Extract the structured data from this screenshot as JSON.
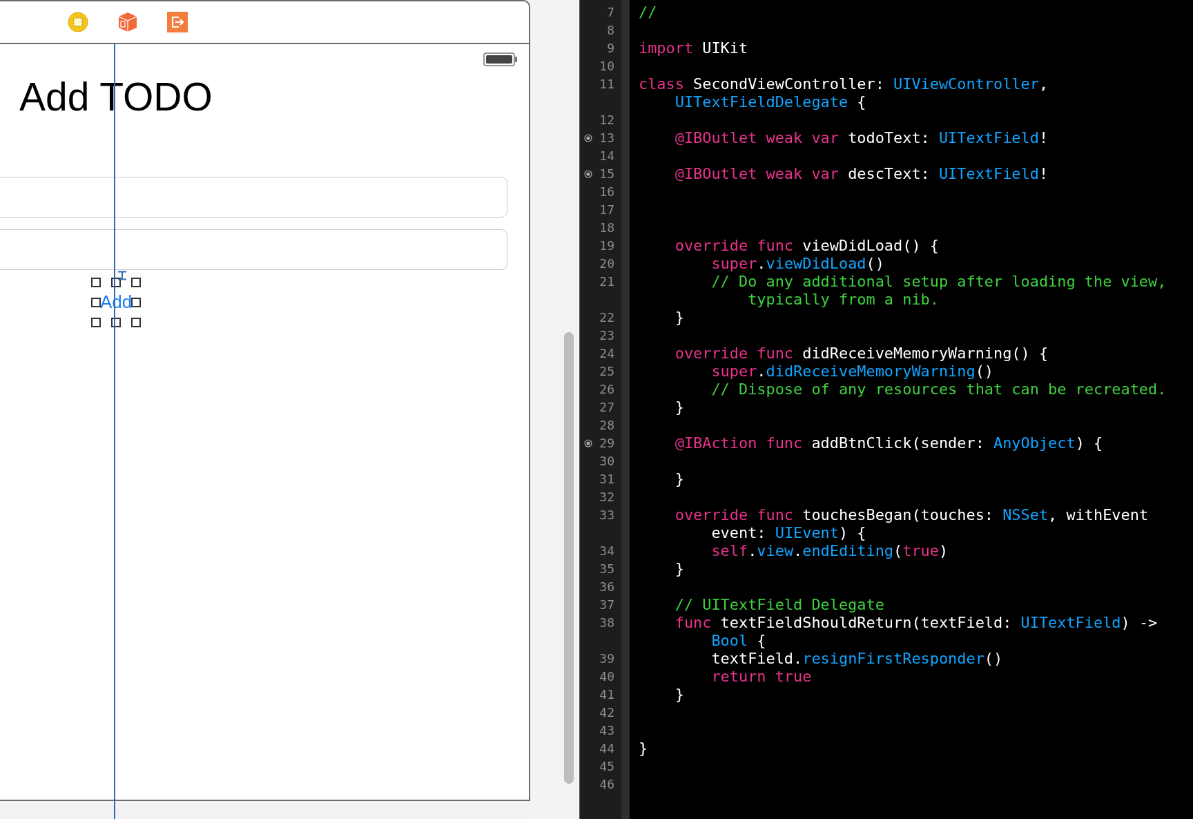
{
  "canvas": {
    "title": "Add TODO",
    "text_fields": [
      {
        "kind": "field"
      },
      {
        "kind": "field"
      }
    ],
    "button": {
      "label": "Add",
      "selected": true
    }
  },
  "editor": {
    "lines": [
      {
        "number": "7",
        "connected": false,
        "tokens": [
          {
            "kind": "comment",
            "text": "//"
          }
        ]
      },
      {
        "number": "8",
        "connected": false
      },
      {
        "number": "9",
        "connected": false,
        "tokens": [
          {
            "kind": "keyword",
            "text": "import"
          },
          {
            "kind": "plain",
            "text": " UIKit"
          }
        ]
      },
      {
        "number": "10",
        "connected": false
      },
      {
        "number": "11",
        "connected": false,
        "tokens": [
          {
            "kind": "keyword",
            "text": "class"
          },
          {
            "kind": "plain",
            "text": " SecondViewController: "
          },
          {
            "kind": "type",
            "text": "UIViewController"
          },
          {
            "kind": "plain",
            "text": ","
          }
        ],
        "wrap": [
          {
            "kind": "type",
            "text": "    UITextFieldDelegate"
          },
          {
            "kind": "plain",
            "text": " {"
          }
        ]
      },
      {
        "number": "12",
        "connected": false
      },
      {
        "number": "13",
        "connected": true,
        "tokens": [
          {
            "kind": "keyword",
            "text": "    @IBOutlet weak var"
          },
          {
            "kind": "plain",
            "text": " todoText: "
          },
          {
            "kind": "type",
            "text": "UITextField"
          },
          {
            "kind": "plain",
            "text": "!"
          }
        ]
      },
      {
        "number": "14",
        "connected": false
      },
      {
        "number": "15",
        "connected": true,
        "tokens": [
          {
            "kind": "keyword",
            "text": "    @IBOutlet weak var"
          },
          {
            "kind": "plain",
            "text": " descText: "
          },
          {
            "kind": "type",
            "text": "UITextField"
          },
          {
            "kind": "plain",
            "text": "!"
          }
        ]
      },
      {
        "number": "16",
        "connected": false
      },
      {
        "number": "17",
        "connected": false
      },
      {
        "number": "18",
        "connected": false
      },
      {
        "number": "19",
        "connected": false,
        "tokens": [
          {
            "kind": "keyword",
            "text": "    override func"
          },
          {
            "kind": "plain",
            "text": " viewDidLoad() {"
          }
        ]
      },
      {
        "number": "20",
        "connected": false,
        "tokens": [
          {
            "kind": "keyword",
            "text": "        super"
          },
          {
            "kind": "plain",
            "text": "."
          },
          {
            "kind": "type",
            "text": "viewDidLoad"
          },
          {
            "kind": "plain",
            "text": "()"
          }
        ]
      },
      {
        "number": "21",
        "connected": false,
        "tokens": [
          {
            "kind": "comment",
            "text": "        // Do any additional setup after loading the view,"
          }
        ],
        "wrap": [
          {
            "kind": "comment",
            "text": "            typically from a nib."
          }
        ]
      },
      {
        "number": "22",
        "connected": false,
        "tokens": [
          {
            "kind": "plain",
            "text": "    }"
          }
        ]
      },
      {
        "number": "23",
        "connected": false
      },
      {
        "number": "24",
        "connected": false,
        "tokens": [
          {
            "kind": "keyword",
            "text": "    override func"
          },
          {
            "kind": "plain",
            "text": " didReceiveMemoryWarning() {"
          }
        ]
      },
      {
        "number": "25",
        "connected": false,
        "tokens": [
          {
            "kind": "keyword",
            "text": "        super"
          },
          {
            "kind": "plain",
            "text": "."
          },
          {
            "kind": "type",
            "text": "didReceiveMemoryWarning"
          },
          {
            "kind": "plain",
            "text": "()"
          }
        ]
      },
      {
        "number": "26",
        "connected": false,
        "tokens": [
          {
            "kind": "comment",
            "text": "        // Dispose of any resources that can be recreated."
          }
        ]
      },
      {
        "number": "27",
        "connected": false,
        "tokens": [
          {
            "kind": "plain",
            "text": "    }"
          }
        ]
      },
      {
        "number": "28",
        "connected": false
      },
      {
        "number": "29",
        "connected": true,
        "tokens": [
          {
            "kind": "keyword",
            "text": "    @IBAction func"
          },
          {
            "kind": "plain",
            "text": " addBtnClick(sender: "
          },
          {
            "kind": "type",
            "text": "AnyObject"
          },
          {
            "kind": "plain",
            "text": ") {"
          }
        ]
      },
      {
        "number": "30",
        "connected": false
      },
      {
        "number": "31",
        "connected": false,
        "tokens": [
          {
            "kind": "plain",
            "text": "    }"
          }
        ]
      },
      {
        "number": "32",
        "connected": false
      },
      {
        "number": "33",
        "connected": false,
        "tokens": [
          {
            "kind": "keyword",
            "text": "    override func"
          },
          {
            "kind": "plain",
            "text": " touchesBegan(touches: "
          },
          {
            "kind": "type",
            "text": "NSSet"
          },
          {
            "kind": "plain",
            "text": ", withEvent"
          }
        ],
        "wrap": [
          {
            "kind": "plain",
            "text": "        event: "
          },
          {
            "kind": "type",
            "text": "UIEvent"
          },
          {
            "kind": "plain",
            "text": ") {"
          }
        ]
      },
      {
        "number": "34",
        "connected": false,
        "tokens": [
          {
            "kind": "keyword",
            "text": "        self"
          },
          {
            "kind": "plain",
            "text": "."
          },
          {
            "kind": "type",
            "text": "view"
          },
          {
            "kind": "plain",
            "text": "."
          },
          {
            "kind": "type",
            "text": "endEditing"
          },
          {
            "kind": "plain",
            "text": "("
          },
          {
            "kind": "keyword",
            "text": "true"
          },
          {
            "kind": "plain",
            "text": ")"
          }
        ]
      },
      {
        "number": "35",
        "connected": false,
        "tokens": [
          {
            "kind": "plain",
            "text": "    }"
          }
        ]
      },
      {
        "number": "36",
        "connected": false
      },
      {
        "number": "37",
        "connected": false,
        "tokens": [
          {
            "kind": "comment",
            "text": "    // UITextField Delegate"
          }
        ]
      },
      {
        "number": "38",
        "connected": false,
        "tokens": [
          {
            "kind": "keyword",
            "text": "    func"
          },
          {
            "kind": "plain",
            "text": " textFieldShouldReturn(textField: "
          },
          {
            "kind": "type",
            "text": "UITextField"
          },
          {
            "kind": "plain",
            "text": ") ->"
          }
        ],
        "wrap": [
          {
            "kind": "type",
            "text": "        Bool"
          },
          {
            "kind": "plain",
            "text": " {"
          }
        ]
      },
      {
        "number": "39",
        "connected": false,
        "tokens": [
          {
            "kind": "plain",
            "text": "        textField."
          },
          {
            "kind": "type",
            "text": "resignFirstResponder"
          },
          {
            "kind": "plain",
            "text": "()"
          }
        ]
      },
      {
        "number": "40",
        "connected": false,
        "tokens": [
          {
            "kind": "keyword",
            "text": "        return true"
          }
        ]
      },
      {
        "number": "41",
        "connected": false,
        "tokens": [
          {
            "kind": "plain",
            "text": "    }"
          }
        ]
      },
      {
        "number": "42",
        "connected": false
      },
      {
        "number": "43",
        "connected": false
      },
      {
        "number": "44",
        "connected": false,
        "tokens": [
          {
            "kind": "plain",
            "text": "}"
          }
        ]
      },
      {
        "number": "45",
        "connected": false
      },
      {
        "number": "46",
        "connected": false
      }
    ]
  }
}
